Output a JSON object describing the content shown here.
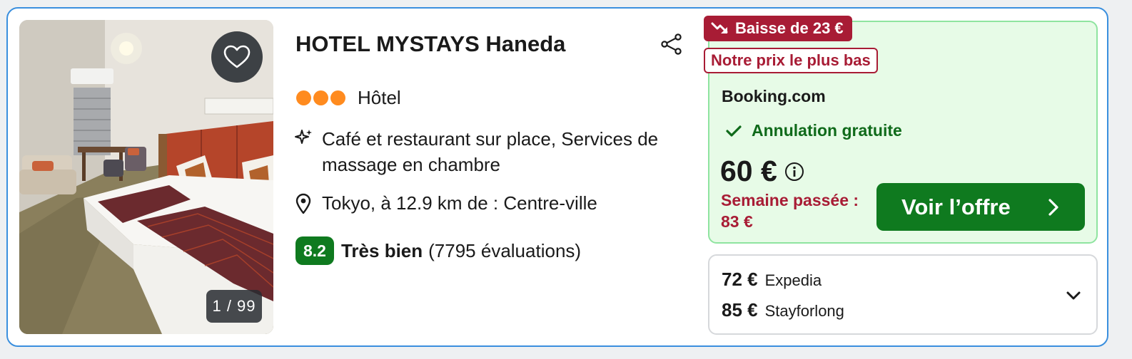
{
  "hotel": {
    "name": "HOTEL MYSTAYS Haneda",
    "image_counter": "1 / 99",
    "star_dots": 3,
    "type": "Hôtel",
    "amenities": "Café et restaurant sur place, Services de massage en chambre",
    "location": "Tokyo, à 12.9 km de : Centre-ville",
    "rating": {
      "score": "8.2",
      "label": "Très bien",
      "reviews": "(7795 évaluations)"
    }
  },
  "deal": {
    "price_drop_badge": "Baisse de 23 €",
    "lowest_badge": "Notre prix le plus bas",
    "provider": "Booking.com",
    "cancellation": "Annulation gratuite",
    "price": "60 €",
    "last_week": "Semaine passée : 83 €",
    "cta_label": "Voir l’offre"
  },
  "other_offers": [
    {
      "price": "72 €",
      "site": "Expedia"
    },
    {
      "price": "85 €",
      "site": "Stayforlong"
    }
  ],
  "colors": {
    "card_border": "#3a8fde",
    "deal_bg": "#e7fbe7",
    "deal_border": "#8fe4a0",
    "accent_green": "#0f7a1f",
    "accent_red": "#a81c35",
    "star_orange": "#ff8b1f"
  },
  "icons": {
    "favorite": "heart-icon",
    "share": "share-icon",
    "amenities": "sparkle-icon",
    "location": "map-pin-icon",
    "cancellation": "check-icon",
    "price_info": "info-icon",
    "price_drop": "trend-down-icon",
    "cta": "chevron-right-icon",
    "expand": "chevron-down-icon"
  }
}
